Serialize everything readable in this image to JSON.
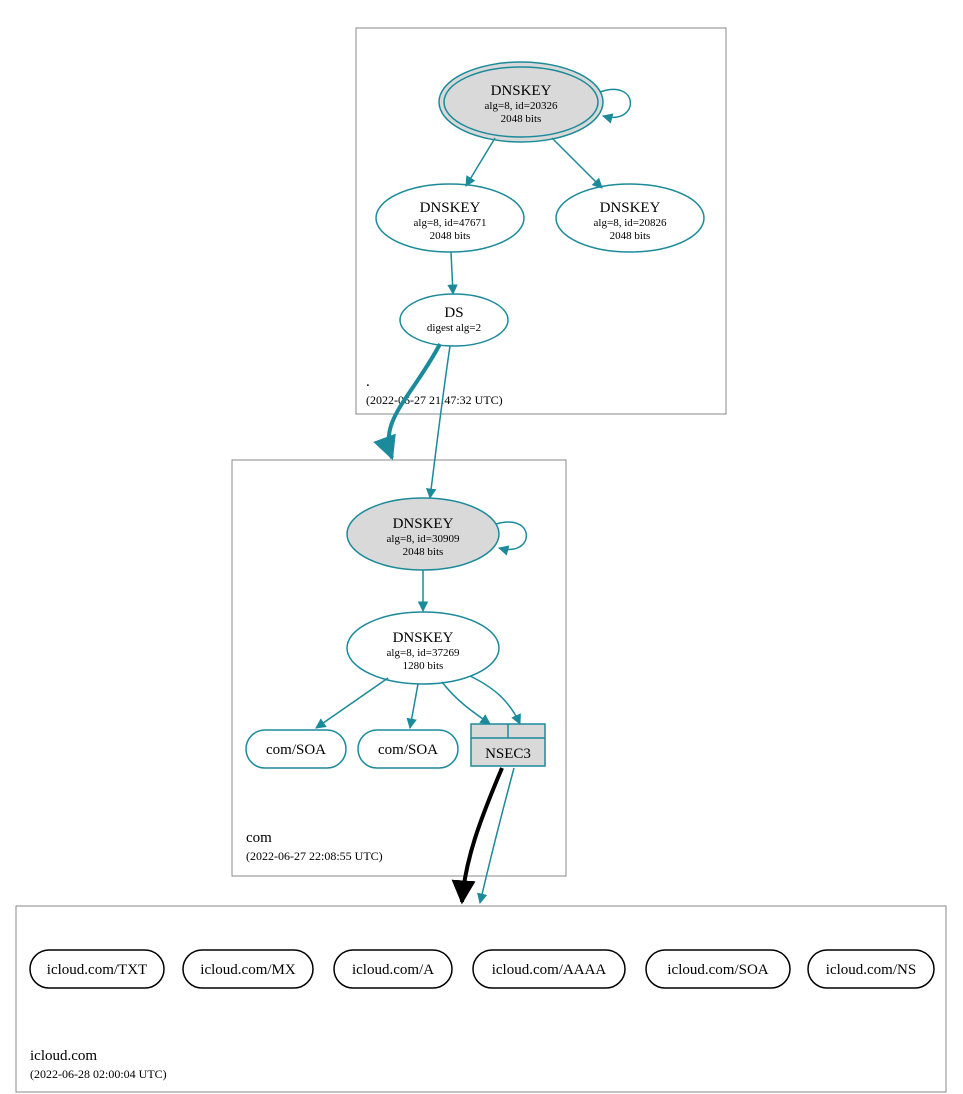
{
  "colors": {
    "teal": "#1b8a9a",
    "node_fill_grey": "#d9d9d9",
    "node_fill_white": "#ffffff",
    "black": "#000000"
  },
  "zones": {
    "root": {
      "label": ".",
      "timestamp": "(2022-06-27 21:47:32 UTC)",
      "nodes": {
        "ksk": {
          "title": "DNSKEY",
          "line1": "alg=8, id=20326",
          "line2": "2048 bits"
        },
        "zsk_left": {
          "title": "DNSKEY",
          "line1": "alg=8, id=47671",
          "line2": "2048 bits"
        },
        "zsk_right": {
          "title": "DNSKEY",
          "line1": "alg=8, id=20826",
          "line2": "2048 bits"
        },
        "ds": {
          "title": "DS",
          "line1": "digest alg=2"
        }
      }
    },
    "com": {
      "label": "com",
      "timestamp": "(2022-06-27 22:08:55 UTC)",
      "nodes": {
        "ksk": {
          "title": "DNSKEY",
          "line1": "alg=8, id=30909",
          "line2": "2048 bits"
        },
        "zsk": {
          "title": "DNSKEY",
          "line1": "alg=8, id=37269",
          "line2": "1280 bits"
        },
        "soa1": {
          "title": "com/SOA"
        },
        "soa2": {
          "title": "com/SOA"
        },
        "nsec3": {
          "title": "NSEC3"
        }
      }
    },
    "icloud": {
      "label": "icloud.com",
      "timestamp": "(2022-06-28 02:00:04 UTC)",
      "records": [
        "icloud.com/TXT",
        "icloud.com/MX",
        "icloud.com/A",
        "icloud.com/AAAA",
        "icloud.com/SOA",
        "icloud.com/NS"
      ]
    }
  }
}
